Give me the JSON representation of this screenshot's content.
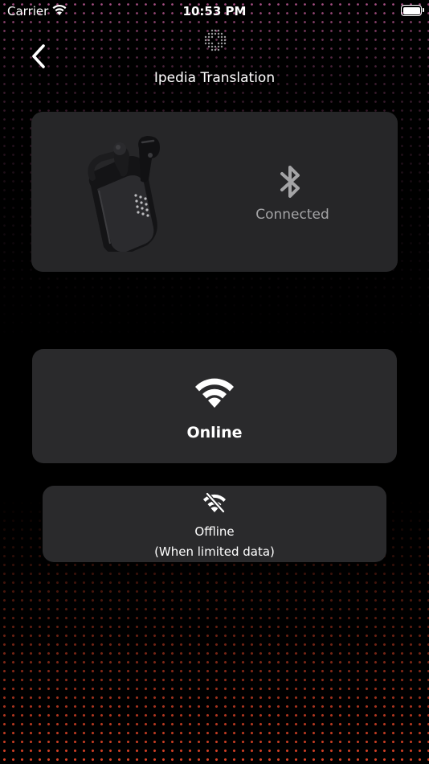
{
  "status_bar": {
    "carrier": "Carrier",
    "time": "10:53 PM"
  },
  "header": {
    "title": "Ipedia Translation",
    "back_icon": "chevron-left-icon",
    "logo_icon": "dot-grid-logo-icon"
  },
  "device": {
    "status": "Connected",
    "status_icon": "bluetooth-icon"
  },
  "modes": {
    "online": {
      "label": "Online",
      "icon": "wifi-icon"
    },
    "offline": {
      "label": "Offline",
      "sublabel": "(When limited data)",
      "icon": "wifi-off-icon"
    }
  },
  "colors": {
    "background": "#000000",
    "card": "#2a2a2c",
    "muted_text": "#a4a4a6",
    "accent_top_dots": "#ff78c8",
    "accent_bottom_dots": "#e64628"
  }
}
